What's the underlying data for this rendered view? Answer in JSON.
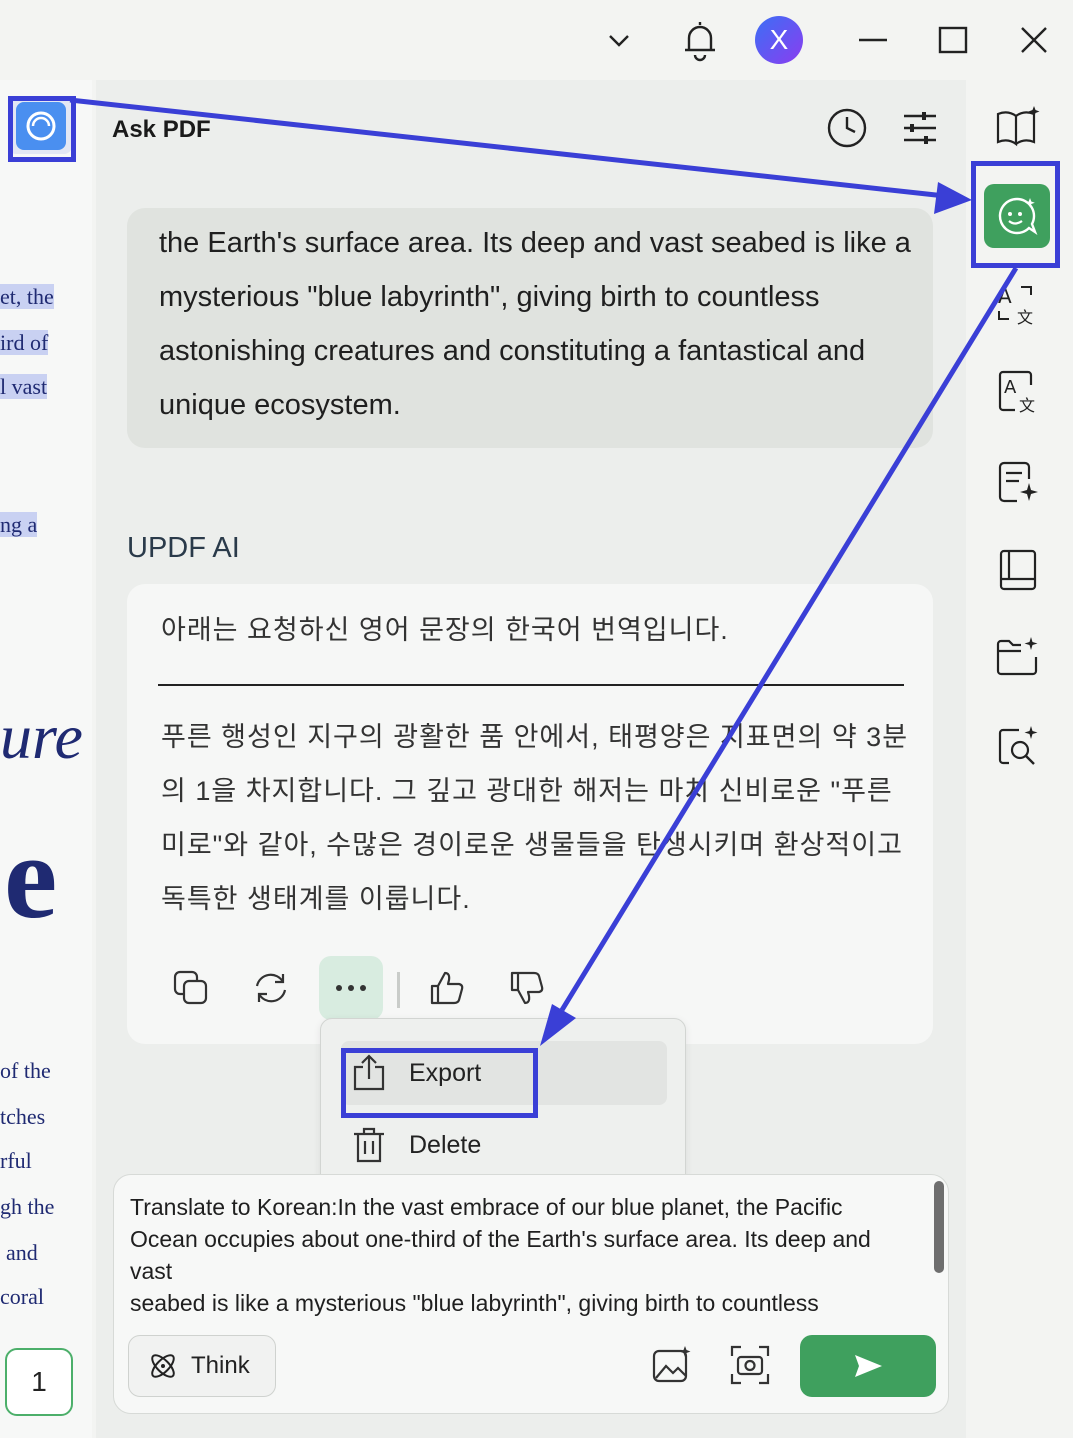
{
  "window": {
    "avatar_letter": "X",
    "icons": [
      "chevron-down-icon",
      "bell-icon",
      "minimize-icon",
      "maximize-icon",
      "close-icon"
    ]
  },
  "document": {
    "lines": [
      "et, the",
      "ird of",
      "l vast",
      "ng a",
      "of the",
      "tches",
      "rful",
      "gh the",
      "and",
      "coral"
    ],
    "big_text_1": "ure",
    "big_text_2": "e",
    "page_number": "1"
  },
  "panel": {
    "title": "Ask PDF",
    "header_icons": [
      "history-icon",
      "settings-sliders-icon"
    ]
  },
  "user_message": {
    "text": "the Earth's surface area. Its deep and vast seabed is like a mysterious \"blue labyrinth\", giving birth to countless astonishing creatures and constituting a fantastical and unique ecosystem."
  },
  "ai_response": {
    "label": "UPDF AI",
    "intro": "아래는 요청하신 영어 문장의 한국어 번역입니다.",
    "body": "푸른 행성인 지구의 광활한 품 안에서, 태평양은 지표면의 약 3분의 1을 차지합니다. 그 깊고 광대한 해저는 마치 신비로운 \"푸른 미로\"와 같아, 수많은 경이로운 생물들을 탄생시키며 환상적이고 독특한 생태계를 이룹니다.",
    "actions": [
      "copy-icon",
      "regenerate-icon",
      "more-icon",
      "thumbs-up-icon",
      "thumbs-down-icon"
    ]
  },
  "context_menu": {
    "items": [
      {
        "label": "Export",
        "icon": "export-icon"
      },
      {
        "label": "Delete",
        "icon": "trash-icon"
      }
    ]
  },
  "input": {
    "text": "Translate to Korean:In the vast embrace of our blue planet, the Pacific\nOcean occupies about one-third of the Earth's surface area. Its deep and\nvast\nseabed is like a mysterious \"blue labyrinth\", giving birth to countless",
    "think_label": "Think",
    "send_icon": "send-icon"
  },
  "rail": {
    "icons": [
      "book-sparkle-icon",
      "ai-chat-icon",
      "translate-icon",
      "translate-box-icon",
      "summary-sparkle-icon",
      "book-icon",
      "folder-sparkle-icon",
      "search-sparkle-icon"
    ]
  },
  "colors": {
    "accent_green": "#3fa05e",
    "annotation_blue": "#3a3fd6",
    "doc_text": "#1f2a72"
  }
}
